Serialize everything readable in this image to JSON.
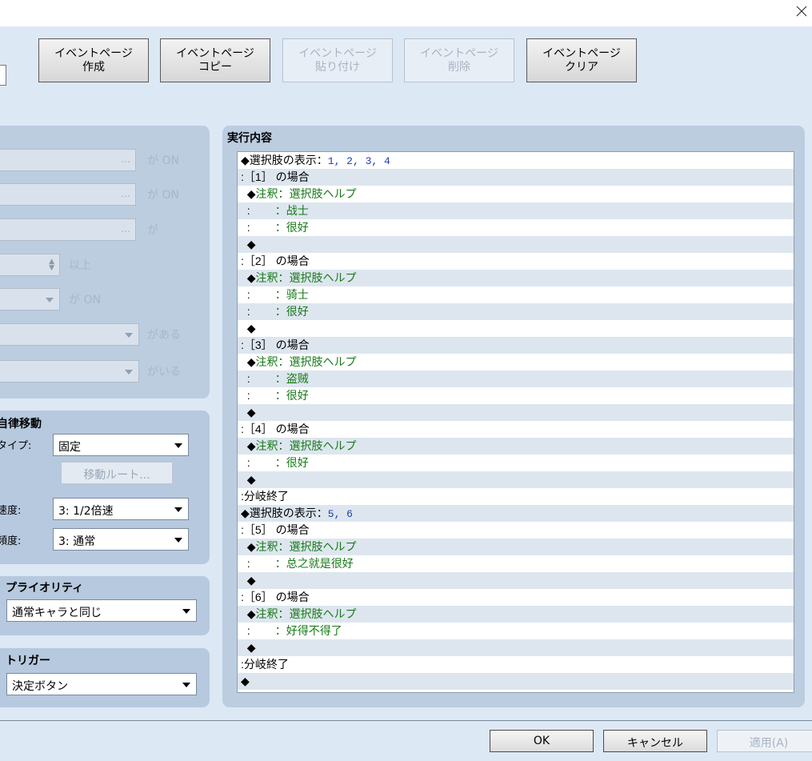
{
  "page_buttons": [
    {
      "line1": "イベントページ",
      "line2": "作成",
      "enabled": true
    },
    {
      "line1": "イベントページ",
      "line2": "コピー",
      "enabled": true
    },
    {
      "line1": "イベントページ",
      "line2": "貼り付け",
      "enabled": false
    },
    {
      "line1": "イベントページ",
      "line2": "削除",
      "enabled": false
    },
    {
      "line1": "イベントページ",
      "line2": "クリア",
      "enabled": true
    }
  ],
  "conditions": {
    "switch1_suffix": "が ON",
    "switch2_suffix": "が ON",
    "variable_suffix": "が",
    "variable_value_suffix": "以上",
    "self_switch_suffix": "が ON",
    "item_suffix": "がある",
    "actor_suffix": "がいる",
    "browse_glyph": "..."
  },
  "autonomous_movement": {
    "title": "自律移動",
    "type_label": "タイプ:",
    "type_value": "固定",
    "route_button": "移動ルート...",
    "speed_label": "速度:",
    "speed_value": "3: 1/2倍速",
    "frequency_label": "頻度:",
    "frequency_value": "3: 通常"
  },
  "priority": {
    "title": "プライオリティ",
    "value": "通常キャラと同じ"
  },
  "trigger": {
    "title": "トリガー",
    "value": "決定ボタン"
  },
  "exec": {
    "title": "実行内容",
    "rows": [
      [
        [
          "k",
          "◆選択肢の表示："
        ],
        [
          "b",
          "1, 2, 3, 4"
        ]
      ],
      [
        [
          "k",
          ":［1］ の場合"
        ]
      ],
      [
        [
          "k",
          "  ◆"
        ],
        [
          "g",
          "注釈：選択肢ヘルプ"
        ]
      ],
      [
        [
          "k",
          "  :        "
        ],
        [
          "g",
          "：战士"
        ]
      ],
      [
        [
          "k",
          "  :        "
        ],
        [
          "g",
          "：很好"
        ]
      ],
      [
        [
          "k",
          "  ◆"
        ]
      ],
      [
        [
          "k",
          ":［2］ の場合"
        ]
      ],
      [
        [
          "k",
          "  ◆"
        ],
        [
          "g",
          "注釈：選択肢ヘルプ"
        ]
      ],
      [
        [
          "k",
          "  :        "
        ],
        [
          "g",
          "：骑士"
        ]
      ],
      [
        [
          "k",
          "  :        "
        ],
        [
          "g",
          "：很好"
        ]
      ],
      [
        [
          "k",
          "  ◆"
        ]
      ],
      [
        [
          "k",
          ":［3］ の場合"
        ]
      ],
      [
        [
          "k",
          "  ◆"
        ],
        [
          "g",
          "注釈：選択肢ヘルプ"
        ]
      ],
      [
        [
          "k",
          "  :        "
        ],
        [
          "g",
          "：盗贼"
        ]
      ],
      [
        [
          "k",
          "  :        "
        ],
        [
          "g",
          "：很好"
        ]
      ],
      [
        [
          "k",
          "  ◆"
        ]
      ],
      [
        [
          "k",
          ":［4］ の場合"
        ]
      ],
      [
        [
          "k",
          "  ◆"
        ],
        [
          "g",
          "注釈：選択肢ヘルプ"
        ]
      ],
      [
        [
          "k",
          "  :        "
        ],
        [
          "g",
          "：很好"
        ]
      ],
      [
        [
          "k",
          "  ◆"
        ]
      ],
      [
        [
          "k",
          ":分岐終了"
        ]
      ],
      [
        [
          "k",
          "◆選択肢の表示："
        ],
        [
          "b",
          "5, 6"
        ]
      ],
      [
        [
          "k",
          ":［5］ の場合"
        ]
      ],
      [
        [
          "k",
          "  ◆"
        ],
        [
          "g",
          "注釈：選択肢ヘルプ"
        ]
      ],
      [
        [
          "k",
          "  :        "
        ],
        [
          "g",
          "：总之就是很好"
        ]
      ],
      [
        [
          "k",
          "  ◆"
        ]
      ],
      [
        [
          "k",
          ":［6］ の場合"
        ]
      ],
      [
        [
          "k",
          "  ◆"
        ],
        [
          "g",
          "注釈：選択肢ヘルプ"
        ]
      ],
      [
        [
          "k",
          "  :        "
        ],
        [
          "g",
          "：好得不得了"
        ]
      ],
      [
        [
          "k",
          "  ◆"
        ]
      ],
      [
        [
          "k",
          ":分岐終了"
        ]
      ],
      [
        [
          "k",
          "◆"
        ]
      ]
    ]
  },
  "footer": {
    "ok": "OK",
    "cancel": "キャンセル",
    "apply": "適用(A)"
  }
}
